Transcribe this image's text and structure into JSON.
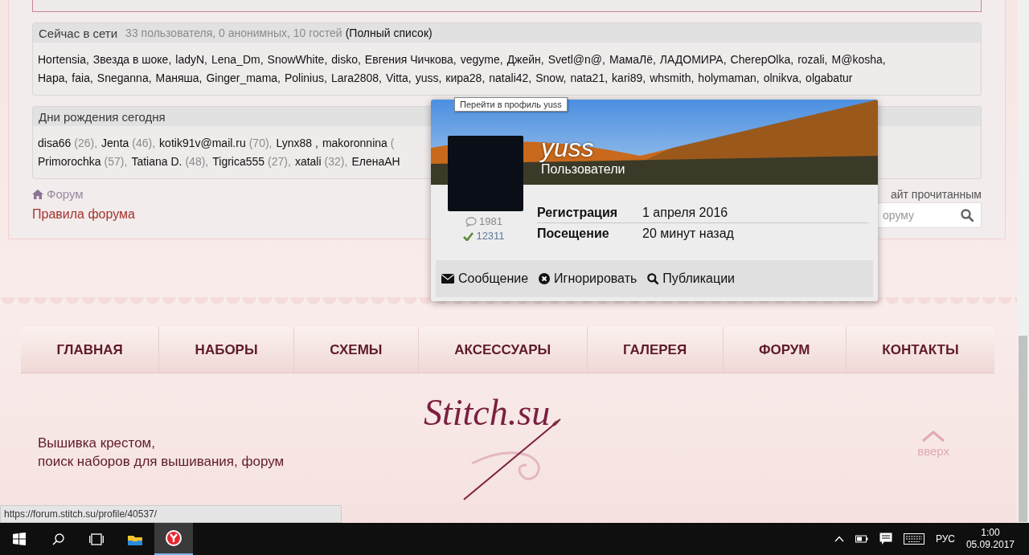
{
  "online": {
    "title": "Сейчас в сети",
    "summary": "33 пользователя, 0 анонимных, 10 гостей",
    "full_list_link": "(Полный список)",
    "lines": [
      [
        "Hortensia,",
        "Звезда в шоке,",
        "ladyN,",
        "Lena_Dm,",
        "SnowWhite,",
        "disko,",
        "Евгения Чичкова,",
        "vegyme,",
        "Джейн,",
        "Svetl@n@,",
        "МамаЛё,",
        "ЛАДОМИРА,",
        "CherepOlka,",
        "rozali,",
        "M@kosha,"
      ],
      [
        "Hapa,",
        "faia,",
        "Sneganna,",
        "Маняша,",
        "Ginger_mama,",
        "Polinius,",
        "Lara2808,",
        "Vitta,",
        "yuss,",
        "кира28,",
        "natali42,",
        "Snow,",
        "nata21,",
        "kari89,",
        "whsmith,",
        "holymaman,",
        "olnikva,",
        "olgabatur"
      ]
    ]
  },
  "birthdays": {
    "title": "Дни рождения сегодня",
    "lines": [
      [
        {
          "name": "disa66",
          "age": "(26),"
        },
        {
          "name": "Jenta",
          "age": "(46),"
        },
        {
          "name": "kotik91v@mail.ru",
          "age": "(70),"
        },
        {
          "name": "Lynx88 ,"
        },
        {
          "name": "makoronnina",
          "age": "("
        }
      ],
      [
        {
          "name": "Primorochka",
          "age": "(57),"
        },
        {
          "name": "Tatiana D.",
          "age": "(48),"
        },
        {
          "name": "Tigrica555",
          "age": "(27),"
        },
        {
          "name": "xatali",
          "age": "(32),"
        },
        {
          "name": "ЕленаАН"
        }
      ]
    ]
  },
  "breadcrumb": "Форум",
  "rules_link": "Правила форума",
  "mark_read_link": "айт прочитанным",
  "search": {
    "placeholder": "оруму"
  },
  "tooltip": "Перейти в профиль yuss",
  "profile_card": {
    "username": "yuss",
    "group": "Пользователи",
    "messages": "1981",
    "reputation": "12311",
    "info": [
      {
        "label": "Регистрация",
        "value": "1 апреля 2016"
      },
      {
        "label": "Посещение",
        "value": "20 минут назад"
      }
    ],
    "actions": [
      {
        "kind": "message",
        "label": "Сообщение"
      },
      {
        "kind": "ignore",
        "label": "Игнорировать"
      },
      {
        "kind": "search",
        "label": "Публикации"
      }
    ]
  },
  "nav": [
    "ГЛАВНАЯ",
    "НАБОРЫ",
    "СХЕМЫ",
    "АКСЕССУАРЫ",
    "ГАЛЕРЕЯ",
    "ФОРУМ",
    "КОНТАКТЫ"
  ],
  "footer": {
    "logo": "Stitch.su",
    "tagline": [
      "Вышивка крестом,",
      "поиск наборов для вышивания, форум"
    ],
    "up_link": "вверх"
  },
  "status_url": "https://forum.stitch.su/profile/40537/",
  "taskbar": {
    "apps": [
      {
        "kind": "explorer",
        "selected": false
      },
      {
        "kind": "browser",
        "selected": true
      }
    ],
    "language": "РУС",
    "time": "1:00",
    "date": "05.09.2017"
  }
}
